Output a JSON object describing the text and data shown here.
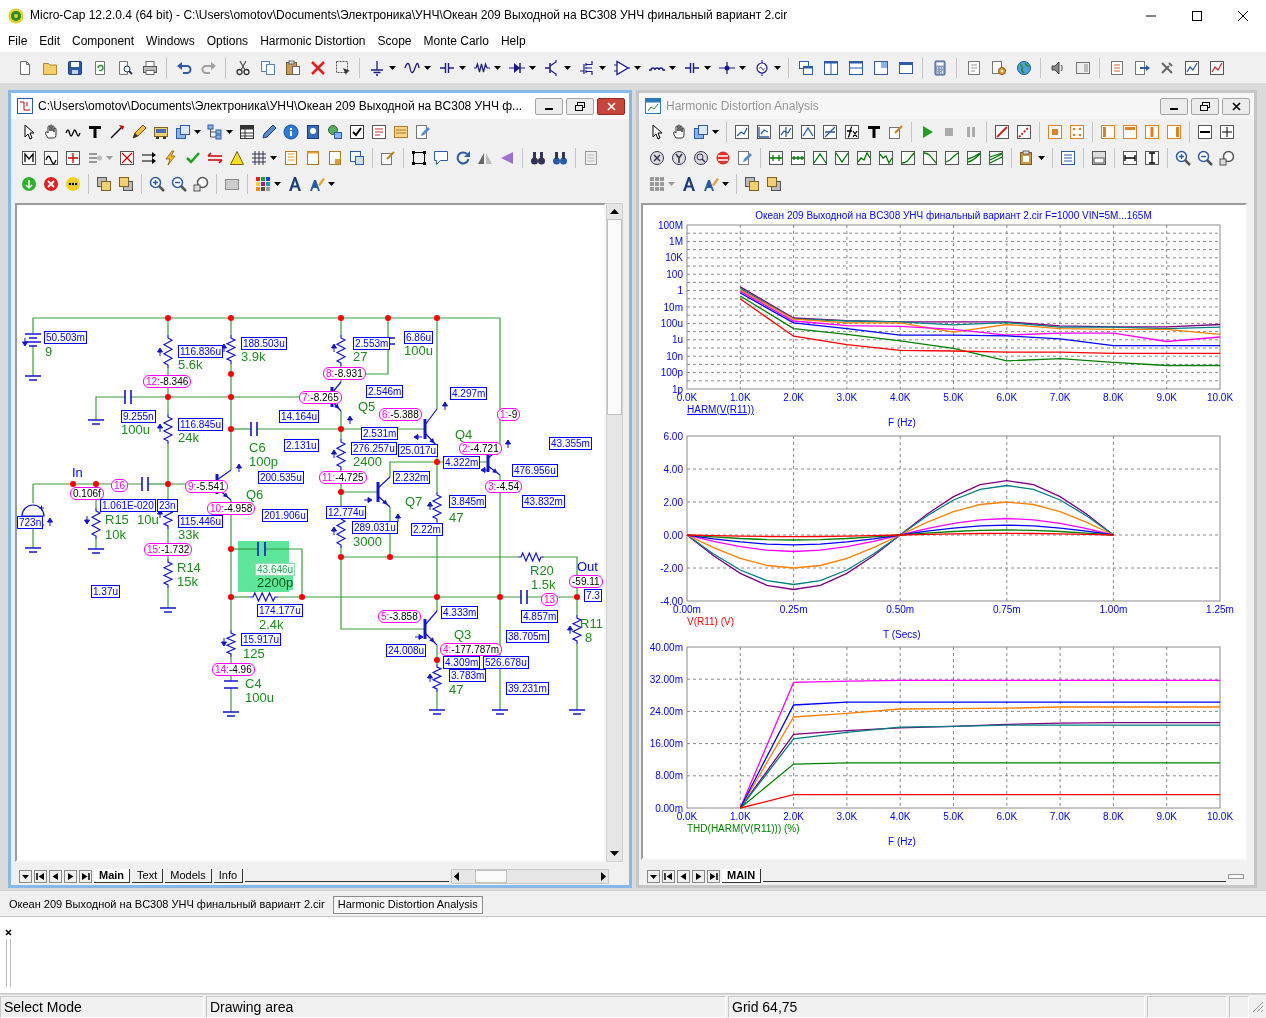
{
  "app": {
    "title": "Micro-Cap 12.2.0.4 (64 bit) - C:\\Users\\omotov\\Documents\\Электроника\\УНЧ\\Океан 209 Выходной на BC308 УНЧ финальный вариант 2.cir",
    "menu": [
      "File",
      "Edit",
      "Component",
      "Windows",
      "Options",
      "Harmonic Distortion",
      "Scope",
      "Monte Carlo",
      "Help"
    ]
  },
  "schematic_window": {
    "title": "C:\\Users\\omotov\\Documents\\Электроника\\УНЧ\\Океан 209 Выходной на BC308 УНЧ ф...",
    "active": true,
    "labels": [
      {
        "kind": "readout",
        "text": "50.503m",
        "selected": false
      },
      {
        "kind": "readout",
        "text": "188.503u",
        "selected": false
      },
      {
        "kind": "readout",
        "text": "2.553m",
        "selected": false
      },
      {
        "kind": "readout",
        "text": "6.86u",
        "selected": false
      },
      {
        "kind": "part",
        "text": "9",
        "selected": false
      },
      {
        "kind": "readout",
        "text": "116.836u",
        "selected": false
      },
      {
        "kind": "part",
        "text": "3.9k",
        "selected": false
      },
      {
        "kind": "part",
        "text": "27",
        "selected": false
      },
      {
        "kind": "part",
        "text": "100u",
        "selected": false
      },
      {
        "kind": "part",
        "text": "5.6k",
        "selected": false
      },
      {
        "kind": "node",
        "number": "8:",
        "text": "-8.931",
        "selected": false
      },
      {
        "kind": "node",
        "number": "12:",
        "text": "-8.346",
        "selected": false
      },
      {
        "kind": "node",
        "number": "7:",
        "text": "-8.265",
        "selected": false
      },
      {
        "kind": "readout",
        "text": "2.546m",
        "selected": false
      },
      {
        "kind": "readout",
        "text": "4.297m",
        "selected": false
      },
      {
        "kind": "part",
        "text": "Q5",
        "selected": false
      },
      {
        "kind": "readout",
        "text": "9.255n",
        "selected": false
      },
      {
        "kind": "readout",
        "text": "14.164u",
        "selected": false
      },
      {
        "kind": "node",
        "number": "6:",
        "text": "-5.388",
        "selected": false
      },
      {
        "kind": "node",
        "number": "1:",
        "text": "-9",
        "selected": false
      },
      {
        "kind": "part",
        "text": "100u",
        "selected": false
      },
      {
        "kind": "readout",
        "text": "116.845u",
        "selected": false
      },
      {
        "kind": "part",
        "text": "24k",
        "selected": false
      },
      {
        "kind": "readout",
        "text": "2.531m",
        "selected": false
      },
      {
        "kind": "part",
        "text": "Q4",
        "selected": false
      },
      {
        "kind": "part",
        "text": "C6",
        "selected": false
      },
      {
        "kind": "readout",
        "text": "2.131u",
        "selected": false
      },
      {
        "kind": "readout",
        "text": "276.257u",
        "selected": false
      },
      {
        "kind": "readout",
        "text": "25.017u",
        "selected": false
      },
      {
        "kind": "node",
        "number": "2:",
        "text": "-4.721",
        "selected": false
      },
      {
        "kind": "readout",
        "text": "43.355m",
        "selected": false
      },
      {
        "kind": "part",
        "text": "100p",
        "selected": false
      },
      {
        "kind": "part",
        "text": "2400",
        "selected": false
      },
      {
        "kind": "readout",
        "text": "4.322m",
        "selected": false
      },
      {
        "kind": "net",
        "text": "In",
        "selected": false
      },
      {
        "kind": "readout",
        "text": "476.956u",
        "selected": false
      },
      {
        "kind": "readout",
        "text": "200.535u",
        "selected": false
      },
      {
        "kind": "node",
        "number": "11:",
        "text": "-4.725",
        "selected": false
      },
      {
        "kind": "readout",
        "text": "2.232m",
        "selected": false
      },
      {
        "kind": "node",
        "number": "16",
        "selected": false
      },
      {
        "kind": "node",
        "number": "9:",
        "text": "-5.541",
        "selected": false
      },
      {
        "kind": "node",
        "number": "3:",
        "text": "-4.54",
        "selected": false
      },
      {
        "kind": "node",
        "text": "0.106f",
        "selected": false
      },
      {
        "kind": "part",
        "text": "Q6",
        "selected": false
      },
      {
        "kind": "readout",
        "text": "1.061E-020",
        "selected": false
      },
      {
        "kind": "readout",
        "text": "23n",
        "selected": false
      },
      {
        "kind": "part",
        "text": "Q7",
        "selected": false
      },
      {
        "kind": "readout",
        "text": "3.845m",
        "selected": false
      },
      {
        "kind": "readout",
        "text": "43.832m",
        "selected": false
      },
      {
        "kind": "node",
        "number": "10:",
        "text": "-4.958",
        "selected": false
      },
      {
        "kind": "readout",
        "text": "723n",
        "selected": false
      },
      {
        "kind": "part",
        "text": "R15",
        "selected": false
      },
      {
        "kind": "part",
        "text": "10u",
        "selected": false
      },
      {
        "kind": "readout",
        "text": "115.446u",
        "selected": false
      },
      {
        "kind": "readout",
        "text": "201.906u",
        "selected": false
      },
      {
        "kind": "readout",
        "text": "12.774u",
        "selected": false
      },
      {
        "kind": "part",
        "text": "47",
        "selected": false
      },
      {
        "kind": "readout",
        "text": "289.031u",
        "selected": false
      },
      {
        "kind": "part",
        "text": "10k",
        "selected": false
      },
      {
        "kind": "part",
        "text": "33k",
        "selected": false
      },
      {
        "kind": "readout",
        "text": "2.22m",
        "selected": false
      },
      {
        "kind": "part",
        "text": "3000",
        "selected": false
      },
      {
        "kind": "node",
        "number": "15:",
        "text": "-1.732",
        "selected": false
      },
      {
        "kind": "part",
        "text": "R14",
        "selected": false
      },
      {
        "kind": "readout",
        "text": "43.646u",
        "selected": true
      },
      {
        "kind": "part",
        "text": "R20",
        "selected": false
      },
      {
        "kind": "net",
        "text": "Out",
        "selected": false
      },
      {
        "kind": "part",
        "text": "15k",
        "selected": false
      },
      {
        "kind": "part",
        "text": "2200p",
        "selected": true
      },
      {
        "kind": "part",
        "text": "1.5k",
        "selected": false
      },
      {
        "kind": "node",
        "text": "-59.11",
        "selected": false
      },
      {
        "kind": "readout",
        "text": "1.37u",
        "selected": false
      },
      {
        "kind": "node",
        "number": "13",
        "selected": false
      },
      {
        "kind": "readout",
        "text": "7.3",
        "selected": false
      },
      {
        "kind": "readout",
        "text": "174.177u",
        "selected": false
      },
      {
        "kind": "node",
        "number": "5:",
        "text": "-3.858",
        "selected": false
      },
      {
        "kind": "readout",
        "text": "4.333m",
        "selected": false
      },
      {
        "kind": "readout",
        "text": "4.857m",
        "selected": false
      },
      {
        "kind": "part",
        "text": "2.4k",
        "selected": false
      },
      {
        "kind": "part",
        "text": "R11",
        "selected": false
      },
      {
        "kind": "readout",
        "text": "15.917u",
        "selected": false
      },
      {
        "kind": "part",
        "text": "Q3",
        "selected": false
      },
      {
        "kind": "readout",
        "text": "38.705m",
        "selected": false
      },
      {
        "kind": "part",
        "text": "8",
        "selected": false
      },
      {
        "kind": "part",
        "text": "125",
        "selected": false
      },
      {
        "kind": "readout",
        "text": "24.008u",
        "selected": false
      },
      {
        "kind": "node",
        "number": "4:",
        "text": "-177.787m",
        "selected": false
      },
      {
        "kind": "readout",
        "text": "4.309m",
        "selected": false
      },
      {
        "kind": "readout",
        "text": "526.678u",
        "selected": false
      },
      {
        "kind": "node",
        "number": "14:",
        "text": "-4.96",
        "selected": false
      },
      {
        "kind": "readout",
        "text": "3.783m",
        "selected": false
      },
      {
        "kind": "part",
        "text": "C4",
        "selected": false
      },
      {
        "kind": "part",
        "text": "47",
        "selected": false
      },
      {
        "kind": "readout",
        "text": "39.231m",
        "selected": false
      },
      {
        "kind": "part",
        "text": "100u",
        "selected": false
      }
    ],
    "tabs": [
      {
        "label": "Main",
        "selected": true
      },
      {
        "label": "Text",
        "selected": false
      },
      {
        "label": "Models",
        "selected": false
      },
      {
        "label": "Info",
        "selected": false
      }
    ]
  },
  "analysis_window": {
    "title": "Harmonic Distortion Analysis",
    "active": false,
    "charts": [
      {
        "title": "Океан 209 Выходной на BC308 УНЧ финальный вариант 2.cir F=1000 VIN=5M...165M",
        "y_axis_labels": [
          "100M",
          "1M",
          "10K",
          "100",
          "1",
          "10m",
          "100u",
          "1u",
          "10n",
          "100p",
          "1p"
        ],
        "x_axis_labels": [
          "0.0K",
          "1.0K",
          "2.0K",
          "3.0K",
          "4.0K",
          "5.0K",
          "6.0K",
          "7.0K",
          "8.0K",
          "9.0K",
          "10.0K"
        ],
        "trace_label": "HARM(V(R11))",
        "x_title": "F (Hz)"
      },
      {
        "chart_data": {
          "type": "line",
          "xlabel": "T (Secs)",
          "grid": true,
          "x": [
            0,
            0.0625,
            0.125,
            0.1875,
            0.25,
            0.3125,
            0.375,
            0.4375,
            0.5,
            0.5625,
            0.625,
            0.6875,
            0.75,
            0.8125,
            0.875,
            0.9375,
            1
          ],
          "series": [
            {
              "color": "#800080",
              "values": [
                0,
                -1.26,
                -2.33,
                -3.05,
                -3.3,
                -3.05,
                -2.33,
                -1.26,
                0,
                1.26,
                2.33,
                3.05,
                3.3,
                3.05,
                2.33,
                1.26,
                0
              ]
            },
            {
              "color": "#008080",
              "values": [
                0,
                -1.15,
                -2.12,
                -2.77,
                -3,
                -2.77,
                -2.12,
                -1.15,
                0,
                1.15,
                2.12,
                2.77,
                3,
                2.77,
                2.12,
                1.15,
                0
              ]
            },
            {
              "color": "#ff8000",
              "values": [
                0,
                -0.77,
                -1.41,
                -1.85,
                -2,
                -1.85,
                -1.41,
                -0.77,
                0,
                0.77,
                1.41,
                1.85,
                2,
                1.85,
                1.41,
                0.77,
                0
              ]
            },
            {
              "color": "#ff00ff",
              "values": [
                0,
                -0.38,
                -0.71,
                -0.92,
                -1,
                -0.92,
                -0.71,
                -0.38,
                0,
                0.38,
                0.71,
                0.92,
                1,
                0.92,
                0.71,
                0.38,
                0
              ]
            },
            {
              "color": "#0000ff",
              "values": [
                0,
                -0.23,
                -0.42,
                -0.55,
                -0.6,
                -0.55,
                -0.42,
                -0.23,
                0,
                0.23,
                0.42,
                0.55,
                0.6,
                0.55,
                0.42,
                0.23,
                0
              ]
            },
            {
              "color": "#008000",
              "values": [
                0,
                -0.11,
                -0.21,
                -0.28,
                -0.3,
                -0.28,
                -0.21,
                -0.11,
                0,
                0.11,
                0.21,
                0.28,
                0.3,
                0.28,
                0.21,
                0.11,
                0
              ]
            },
            {
              "color": "#ff0000",
              "values": [
                0,
                -0.04,
                -0.07,
                -0.09,
                -0.1,
                -0.09,
                -0.07,
                -0.04,
                0,
                0.04,
                0.07,
                0.09,
                0.1,
                0.09,
                0.07,
                0.04,
                0
              ]
            }
          ],
          "xlim": [
            0,
            1.25
          ],
          "ylim": [
            -4,
            6
          ],
          "xticks": [
            {
              "value": 0,
              "label": "0.00m"
            },
            {
              "value": 0.25,
              "label": "0.25m"
            },
            {
              "value": 0.5,
              "label": "0.50m"
            },
            {
              "value": 0.75,
              "label": "0.75m"
            },
            {
              "value": 1,
              "label": "1.00m"
            },
            {
              "value": 1.25,
              "label": "1.25m"
            }
          ],
          "yticks": [
            {
              "value": -4,
              "label": "-4.00"
            },
            {
              "value": -2,
              "label": "-2.00"
            },
            {
              "value": 0,
              "label": "0.00"
            },
            {
              "value": 2,
              "label": "2.00"
            },
            {
              "value": 4,
              "label": "4.00"
            },
            {
              "value": 6,
              "label": "6.00"
            }
          ]
        },
        "trace_label": "V(R11) (V)"
      },
      {
        "chart_data": {
          "type": "line",
          "xlabel": "F (Hz)",
          "grid": true,
          "x": [
            1000,
            2000,
            3000,
            4000,
            5000,
            6000,
            7000,
            8000,
            9000,
            10000
          ],
          "series": [
            {
              "color": "#800080",
              "values": [
                0,
                18.3,
                19.2,
                19.9,
                20.3,
                20.8,
                21.1,
                21.2,
                21.2,
                21.2
              ]
            },
            {
              "color": "#008080",
              "values": [
                0,
                17.2,
                18.8,
                20.1,
                20.3,
                20.6,
                20.6,
                20.6,
                20.6,
                20.6
              ]
            },
            {
              "color": "#ff8000",
              "values": [
                0,
                22.6,
                23.5,
                24.6,
                24.7,
                24.8,
                25.1,
                25.1,
                25.1,
                25.1
              ]
            },
            {
              "color": "#ff00ff",
              "values": [
                0,
                31.2,
                31.5,
                31.7,
                31.7,
                31.7,
                31.7,
                31.7,
                31.7,
                31.7
              ]
            },
            {
              "color": "#0000ff",
              "values": [
                0,
                25.6,
                26.3,
                26.3,
                26.3,
                26.3,
                26.3,
                26.3,
                26.3,
                26.3
              ]
            },
            {
              "color": "#008000",
              "values": [
                0,
                10.9,
                11.2,
                11.2,
                11.2,
                11.2,
                11.2,
                11.2,
                11.2,
                11.2
              ]
            },
            {
              "color": "#ff0000",
              "values": [
                0,
                3.3,
                3.3,
                3.3,
                3.3,
                3.3,
                3.3,
                3.3,
                3.3,
                3.3
              ]
            }
          ],
          "xlim": [
            0,
            10000
          ],
          "ylim": [
            0,
            40
          ],
          "xticks": [
            {
              "value": 0,
              "label": "0.0K"
            },
            {
              "value": 1000,
              "label": "1.0K"
            },
            {
              "value": 2000,
              "label": "2.0K"
            },
            {
              "value": 3000,
              "label": "3.0K"
            },
            {
              "value": 4000,
              "label": "4.0K"
            },
            {
              "value": 5000,
              "label": "5.0K"
            },
            {
              "value": 6000,
              "label": "6.0K"
            },
            {
              "value": 7000,
              "label": "7.0K"
            },
            {
              "value": 8000,
              "label": "8.0K"
            },
            {
              "value": 9000,
              "label": "9.0K"
            },
            {
              "value": 10000,
              "label": "10.0K"
            }
          ],
          "yticks": [
            {
              "value": 0,
              "label": "0.00m"
            },
            {
              "value": 8,
              "label": "8.00m"
            },
            {
              "value": 16,
              "label": "16.00m"
            },
            {
              "value": 24,
              "label": "24.00m"
            },
            {
              "value": 32,
              "label": "32.00m"
            },
            {
              "value": 40,
              "label": "40.00m"
            }
          ]
        },
        "trace_label": "THD(HARM(V(R11))) (%)"
      }
    ],
    "tabs": [
      {
        "label": "MAIN",
        "selected": true
      }
    ]
  },
  "window_tabs": [
    {
      "label": "Океан 209 Выходной на BC308 УНЧ финальный вариант 2.cir",
      "selected": true
    },
    {
      "label": "Harmonic Distortion Analysis",
      "selected": false
    }
  ],
  "status_bar": [
    "Select Mode",
    "Drawing area",
    "Grid 64,75"
  ]
}
